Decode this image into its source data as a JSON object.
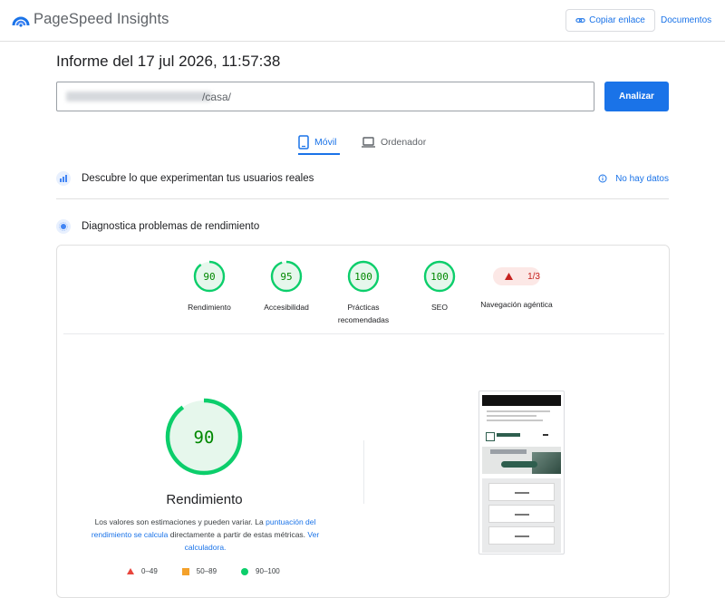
{
  "app": {
    "title": "PageSpeed Insights",
    "copy_link": "Copiar enlace",
    "docs": "Documentos"
  },
  "report": {
    "title": "Informe del 17 jul 2026, 11:57:38",
    "url_path": "/casa/",
    "analyze": "Analizar"
  },
  "tabs": [
    {
      "label": "Móvil",
      "active": true
    },
    {
      "label": "Ordenador",
      "active": false
    }
  ],
  "field_data": {
    "title": "Descubre lo que experimentan tus usuarios reales",
    "no_data": "No hay datos"
  },
  "lab": {
    "title": "Diagnostica problemas de rendimiento"
  },
  "scores": [
    {
      "label": "Rendimiento",
      "value": "90",
      "fraction": 0.9
    },
    {
      "label": "Accesibilidad",
      "value": "95",
      "fraction": 0.95
    },
    {
      "label": "Prácticas recomendadas",
      "value": "100",
      "fraction": 1.0
    },
    {
      "label": "SEO",
      "value": "100",
      "fraction": 1.0
    }
  ],
  "agentic": {
    "label": "Navegación agéntica",
    "value": "1/3"
  },
  "main_score": {
    "value": "90",
    "fraction": 0.9,
    "label": "Rendimiento",
    "desc_1": "Los valores son estimaciones y pueden variar. La ",
    "desc_link_1": "puntuación del rendimiento se calcula",
    "desc_2": " directamente a partir de estas métricas. ",
    "desc_link_2": "Ver calculadora."
  },
  "legend": [
    {
      "range": "0–49",
      "shape": "triangle",
      "color": "#e8453c"
    },
    {
      "range": "50–89",
      "shape": "square",
      "color": "#f4a12b"
    },
    {
      "range": "90–100",
      "shape": "circle",
      "color": "#0cce6b"
    }
  ],
  "colors": {
    "accent": "#1a73e8",
    "pass": "#0cce6b",
    "pass_bg": "#e6f7ec",
    "fail": "#c5221f"
  }
}
